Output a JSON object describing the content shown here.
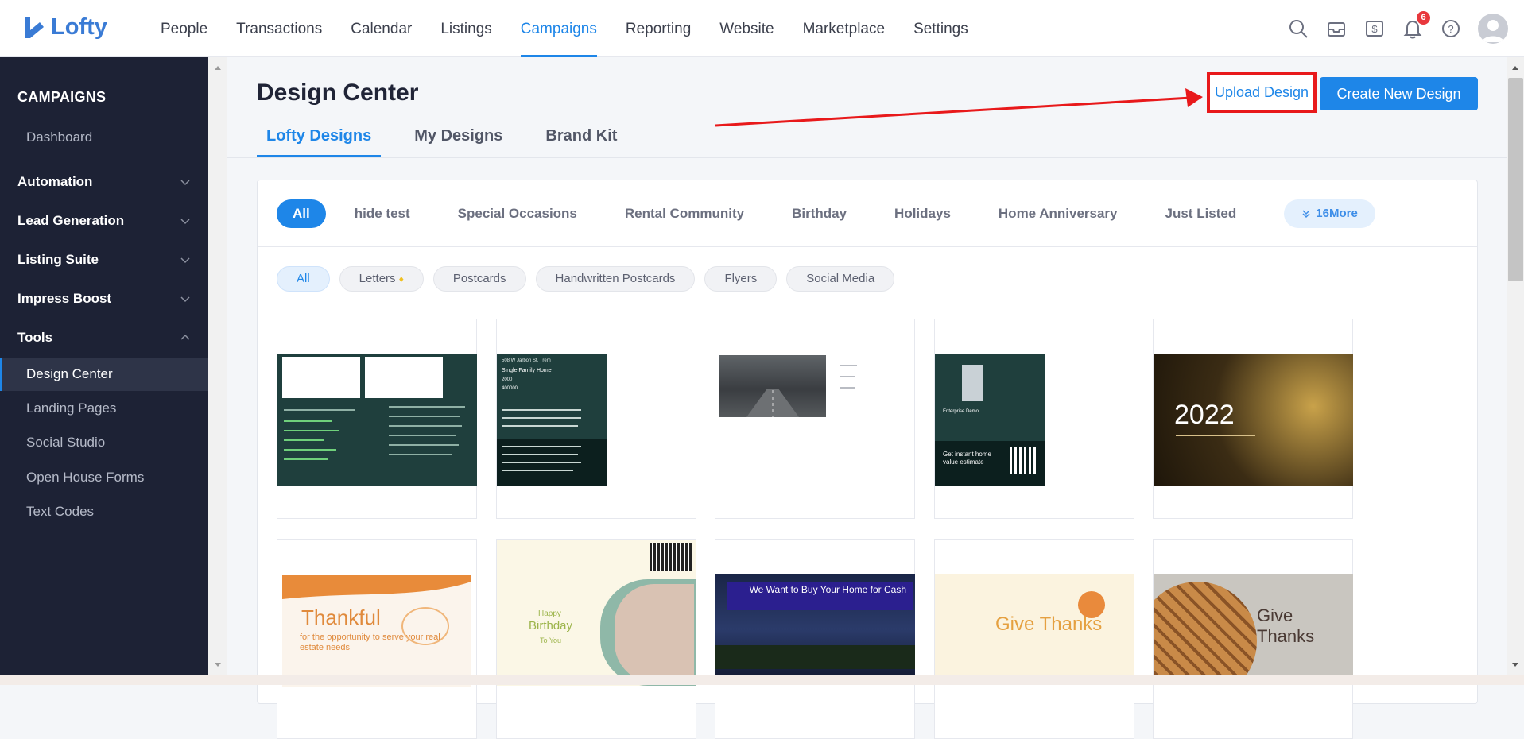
{
  "app": {
    "name": "Lofty"
  },
  "nav": {
    "items": [
      {
        "label": "People"
      },
      {
        "label": "Transactions"
      },
      {
        "label": "Calendar"
      },
      {
        "label": "Listings"
      },
      {
        "label": "Campaigns",
        "active": true
      },
      {
        "label": "Reporting"
      },
      {
        "label": "Website"
      },
      {
        "label": "Marketplace"
      },
      {
        "label": "Settings"
      }
    ]
  },
  "topicons": {
    "notifications_count": "6",
    "icons": [
      "search-icon",
      "inbox-icon",
      "dollar-icon",
      "bell-icon",
      "help-icon",
      "avatar"
    ]
  },
  "sidebar": {
    "title": "CAMPAIGNS",
    "dashboard": "Dashboard",
    "groups": [
      {
        "label": "Automation"
      },
      {
        "label": "Lead Generation"
      },
      {
        "label": "Listing Suite"
      },
      {
        "label": "Impress Boost"
      },
      {
        "label": "Tools"
      }
    ],
    "tools_items": [
      {
        "label": "Design Center",
        "selected": true
      },
      {
        "label": "Landing Pages"
      },
      {
        "label": "Social Studio"
      },
      {
        "label": "Open House Forms"
      },
      {
        "label": "Text Codes"
      }
    ]
  },
  "page": {
    "title": "Design Center",
    "tabs": [
      {
        "label": "Lofty Designs",
        "active": true
      },
      {
        "label": "My Designs"
      },
      {
        "label": "Brand Kit"
      }
    ],
    "upload_label": "Upload Design",
    "create_label": "Create New Design"
  },
  "categories": {
    "items": [
      "All",
      "hide test",
      "Special Occasions",
      "Rental Community",
      "Birthday",
      "Holidays",
      "Home Anniversary",
      "Just Listed"
    ],
    "more_label": "16More"
  },
  "formats": {
    "items": [
      "All",
      "Letters",
      "Postcards",
      "Handwritten Postcards",
      "Flyers",
      "Social Media"
    ]
  },
  "cards": {
    "row1": [
      {
        "type": "listing-letter"
      },
      {
        "type": "listing-flyer",
        "address": "508 W Jarbon St, Trem",
        "subtitle": "Single Family Home",
        "line1": "2000",
        "line2": "400000"
      },
      {
        "type": "road-photo"
      },
      {
        "type": "agent-postcard",
        "agent": "Enterprise Demo",
        "cta": "Get instant home value estimate"
      },
      {
        "type": "new-year",
        "year": "2022"
      }
    ],
    "row2": [
      {
        "type": "thankful",
        "headline": "Thankful",
        "tagline": "for the opportunity to serve your real estate needs"
      },
      {
        "type": "birthday",
        "small": "Happy",
        "headline": "Birthday",
        "sub": "To You"
      },
      {
        "type": "buy-home",
        "headline": "We Want to Buy Your Home for Cash"
      },
      {
        "type": "give-thanks",
        "headline": "Give Thanks"
      },
      {
        "type": "pie",
        "headline": "Give Thanks"
      }
    ]
  },
  "colors": {
    "accent": "#1e86e8",
    "sidebar_bg": "#1d2235",
    "highlight_red": "#e8191b"
  }
}
